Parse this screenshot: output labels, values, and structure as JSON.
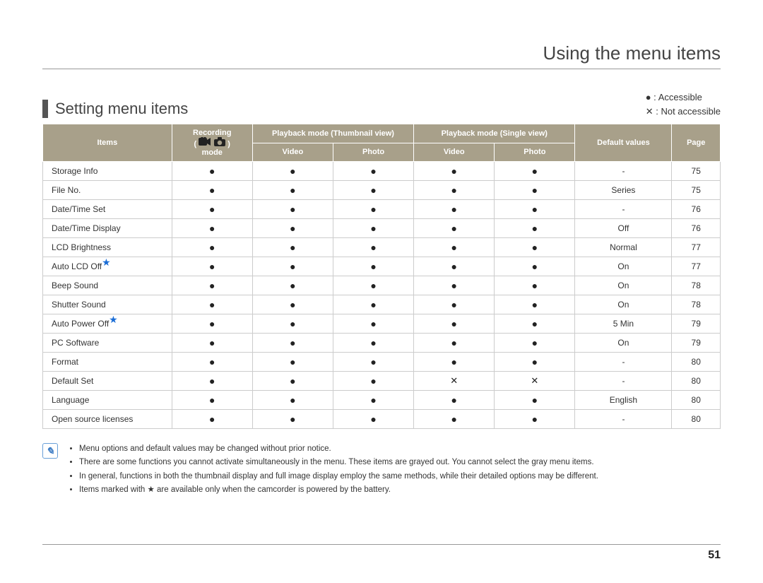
{
  "page": {
    "title": "Using the menu items",
    "section_title": "Setting menu items",
    "page_number": "51"
  },
  "legend": {
    "accessible": "● : Accessible",
    "not_accessible": "✕ : Not accessible"
  },
  "headers": {
    "items": "Items",
    "recording_top": "Recording",
    "recording_bottom": "mode",
    "thumb": "Playback mode (Thumbnail view)",
    "single": "Playback mode (Single view)",
    "video1": "Video",
    "photo1": "Photo",
    "video2": "Video",
    "photo2": "Photo",
    "default": "Default values",
    "page": "Page"
  },
  "rows": [
    {
      "name": "Storage Info",
      "star": false,
      "rec": "●",
      "tv": "●",
      "tp": "●",
      "sv": "●",
      "sp": "●",
      "def": "-",
      "pg": "75"
    },
    {
      "name": "File No.",
      "star": false,
      "rec": "●",
      "tv": "●",
      "tp": "●",
      "sv": "●",
      "sp": "●",
      "def": "Series",
      "pg": "75"
    },
    {
      "name": "Date/Time Set",
      "star": false,
      "rec": "●",
      "tv": "●",
      "tp": "●",
      "sv": "●",
      "sp": "●",
      "def": "-",
      "pg": "76"
    },
    {
      "name": "Date/Time Display",
      "star": false,
      "rec": "●",
      "tv": "●",
      "tp": "●",
      "sv": "●",
      "sp": "●",
      "def": "Off",
      "pg": "76"
    },
    {
      "name": "LCD Brightness",
      "star": false,
      "rec": "●",
      "tv": "●",
      "tp": "●",
      "sv": "●",
      "sp": "●",
      "def": "Normal",
      "pg": "77"
    },
    {
      "name": "Auto LCD Off",
      "star": true,
      "rec": "●",
      "tv": "●",
      "tp": "●",
      "sv": "●",
      "sp": "●",
      "def": "On",
      "pg": "77"
    },
    {
      "name": "Beep Sound",
      "star": false,
      "rec": "●",
      "tv": "●",
      "tp": "●",
      "sv": "●",
      "sp": "●",
      "def": "On",
      "pg": "78"
    },
    {
      "name": "Shutter Sound",
      "star": false,
      "rec": "●",
      "tv": "●",
      "tp": "●",
      "sv": "●",
      "sp": "●",
      "def": "On",
      "pg": "78"
    },
    {
      "name": "Auto Power Off",
      "star": true,
      "rec": "●",
      "tv": "●",
      "tp": "●",
      "sv": "●",
      "sp": "●",
      "def": "5 Min",
      "pg": "79"
    },
    {
      "name": "PC Software",
      "star": false,
      "rec": "●",
      "tv": "●",
      "tp": "●",
      "sv": "●",
      "sp": "●",
      "def": "On",
      "pg": "79"
    },
    {
      "name": "Format",
      "star": false,
      "rec": "●",
      "tv": "●",
      "tp": "●",
      "sv": "●",
      "sp": "●",
      "def": "-",
      "pg": "80"
    },
    {
      "name": "Default Set",
      "star": false,
      "rec": "●",
      "tv": "●",
      "tp": "●",
      "sv": "✕",
      "sp": "✕",
      "def": "-",
      "pg": "80"
    },
    {
      "name": "Language",
      "star": false,
      "rec": "●",
      "tv": "●",
      "tp": "●",
      "sv": "●",
      "sp": "●",
      "def": "English",
      "pg": "80"
    },
    {
      "name": "Open source licenses",
      "star": false,
      "rec": "●",
      "tv": "●",
      "tp": "●",
      "sv": "●",
      "sp": "●",
      "def": "-",
      "pg": "80"
    }
  ],
  "notes": [
    "Menu options and default values may be changed without prior notice.",
    "There are some functions you cannot activate simultaneously in the menu. These items are grayed out. You cannot select the gray menu items.",
    "In general, functions in both the thumbnail display and full image display employ the same methods, while their detailed options may be different.",
    "Items marked with ★ are available only when the camcorder is powered by the battery."
  ]
}
